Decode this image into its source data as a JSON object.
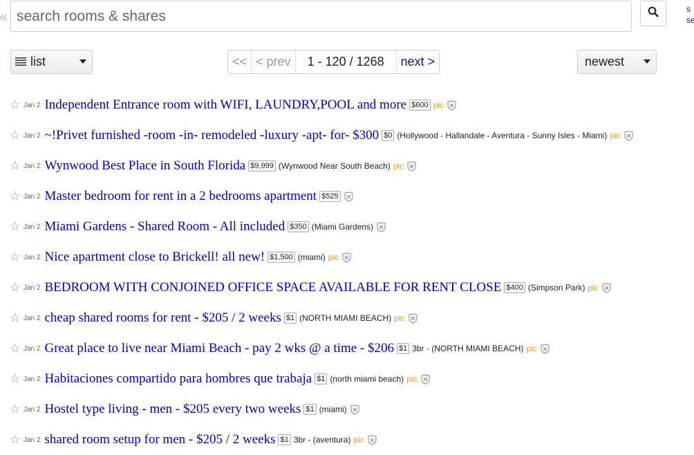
{
  "search": {
    "placeholder": "search rooms & shares",
    "value": ""
  },
  "top_right": {
    "line1": "s",
    "line2": "se"
  },
  "view": {
    "label": "list"
  },
  "pager": {
    "first": "<<",
    "prev": "< prev",
    "range": "1 - 120 / 1268",
    "next": "next >"
  },
  "sort": {
    "label": "newest"
  },
  "results": [
    {
      "date": "Jan 2",
      "title": "Independent Entrance room with WIFI, LAUNDRY,POOL and more",
      "price": "$600",
      "hood": "",
      "pic": "pic"
    },
    {
      "date": "Jan 2",
      "title": "~!Privet furnished -room -in- remodeled -luxury -apt- for- $300",
      "price": "$0",
      "hood": "(Hollywood - Hallandale - Aventura - Sunny Isles - Miami)",
      "pic": "pic"
    },
    {
      "date": "Jan 2",
      "title": "Wynwood Best Place in South Florida",
      "price": "$9,999",
      "hood": "(Wynwood Near South Beach)",
      "pic": "pic"
    },
    {
      "date": "Jan 2",
      "title": "Master bedroom for rent in a 2 bedrooms apartment",
      "price": "$525",
      "hood": "",
      "pic": ""
    },
    {
      "date": "Jan 2",
      "title": "Miami Gardens - Shared Room - All included",
      "price": "$350",
      "hood": "(Miami Gardens)",
      "pic": ""
    },
    {
      "date": "Jan 2",
      "title": "Nice apartment close to Brickell! all new!",
      "price": "$1,500",
      "hood": "(miami)",
      "pic": "pic"
    },
    {
      "date": "Jan 2",
      "title": "BEDROOM WITH CONJOINED OFFICE SPACE AVAILABLE FOR RENT CLOSE",
      "price": "$400",
      "hood": "(Simpson Park)",
      "pic": "pic"
    },
    {
      "date": "Jan 2",
      "title": "cheap shared rooms for rent - $205 / 2 weeks",
      "price": "$1",
      "hood": "(NORTH MIAMI BEACH)",
      "pic": "pic"
    },
    {
      "date": "Jan 2",
      "title": "Great place to live near Miami Beach - pay 2 wks @ a time - $206",
      "price": "$1",
      "hood": "3br - (NORTH MIAMI BEACH)",
      "pic": "pic"
    },
    {
      "date": "Jan 2",
      "title": "Habitaciones compartido para hombres que trabaja",
      "price": "$1",
      "hood": "(north miami beach)",
      "pic": "pic"
    },
    {
      "date": "Jan 2",
      "title": "Hostel type living - men - $205 every two weeks",
      "price": "$1",
      "hood": "(miami)",
      "pic": ""
    },
    {
      "date": "Jan 2",
      "title": "shared room setup for men - $205 / 2 weeks",
      "price": "$1",
      "hood": "3br - (aventura)",
      "pic": "pic"
    }
  ]
}
